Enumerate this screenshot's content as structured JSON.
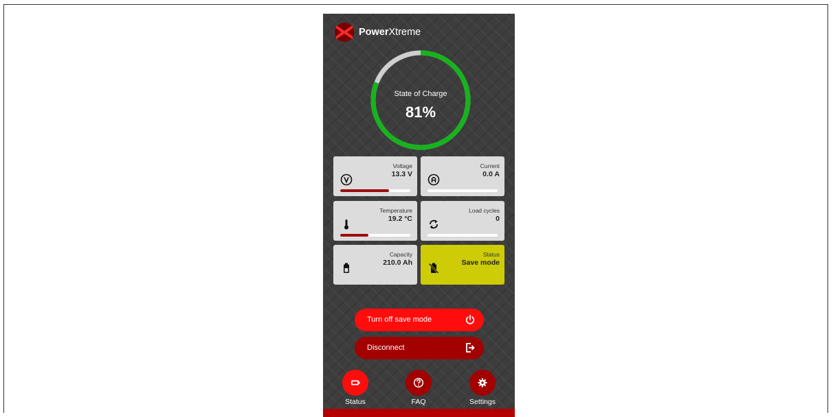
{
  "app": {
    "logo_bold": "Power",
    "logo_rest": "Xtreme"
  },
  "gauge": {
    "label": "State of Charge",
    "value": "81%",
    "percent": 81,
    "track_color": "#cfcfcf",
    "fill_color": "#16b41c"
  },
  "tiles": {
    "voltage": {
      "label": "Voltage",
      "value": "13.3 V",
      "bar_fraction": 0.7,
      "icon": "voltage-icon"
    },
    "current": {
      "label": "Current",
      "value": "0.0 A",
      "bar_fraction": 0.0,
      "icon": "ampere-icon"
    },
    "temperature": {
      "label": "Temperature",
      "value": "19.2 °C",
      "bar_fraction": 0.4,
      "icon": "thermometer-icon"
    },
    "load_cycles": {
      "label": "Load cycles",
      "value": "0",
      "bar_fraction": 0.0,
      "icon": "cycle-icon"
    },
    "capacity": {
      "label": "Capacity",
      "value": "210.0 Ah",
      "icon": "battery-icon"
    },
    "status": {
      "label": "Status",
      "value": "Save mode",
      "icon": "battery-off-icon",
      "color": "#cdcc07"
    }
  },
  "actions": {
    "save_mode": {
      "label": "Turn off save mode",
      "icon": "power-icon",
      "color": "#ff0d0d"
    },
    "disconnect": {
      "label": "Disconnect",
      "icon": "logout-icon",
      "color": "#a30000"
    }
  },
  "nav": {
    "status": {
      "label": "Status",
      "icon": "battery-icon",
      "active": true
    },
    "faq": {
      "label": "FAQ",
      "icon": "question-icon"
    },
    "settings": {
      "label": "Settings",
      "icon": "gear-icon"
    }
  }
}
